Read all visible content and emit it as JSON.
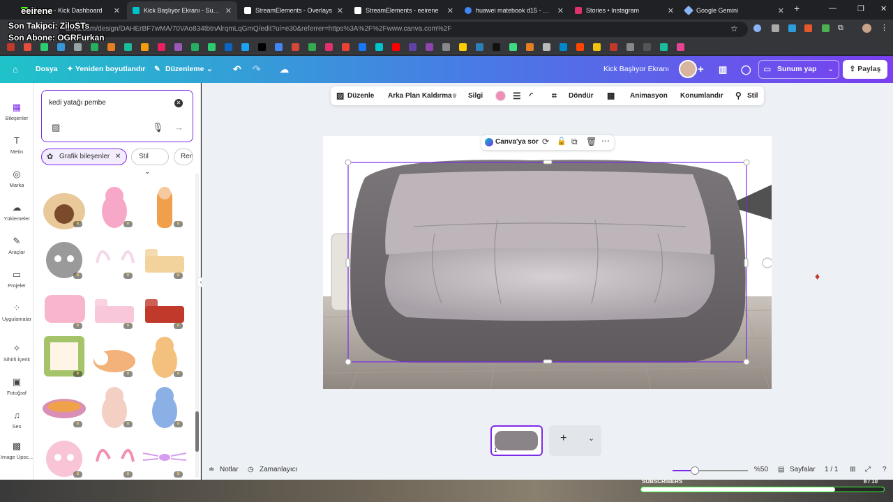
{
  "browser": {
    "tabs": [
      {
        "label": "Stream - Kick Dashboard",
        "fav": "#53fc18",
        "active": false
      },
      {
        "label": "Kick Başlıyor Ekranı - Sunum",
        "fav": "#00c4cc",
        "active": true
      },
      {
        "label": "StreamElements - Overlays",
        "fav": "#ffffff",
        "active": false
      },
      {
        "label": "StreamElements - eeirene",
        "fav": "#ffffff",
        "active": false
      },
      {
        "label": "huawei matebook d15 - Googl",
        "fav": "#4285f4",
        "active": false
      },
      {
        "label": "Stories • Instagram",
        "fav": "#e1306c",
        "active": false
      },
      {
        "label": "Google Gemini",
        "fav": "#8ab4f8",
        "active": false
      }
    ],
    "new_tab": "+",
    "url": "anva.com/design/DAHErBF7wMA/70VAo834tbtnAlrqmLqGmQ/edit?ui=e30&referrer=https%3A%2F%2Fwww.canva.com%2F"
  },
  "overlay": {
    "channel": "eeirene",
    "follower": "Son Takipci: ZiloSTs",
    "subscriber": "Son Abone: OGRFurkan"
  },
  "header": {
    "file": "Dosya",
    "resize": "Yeniden boyutlandır",
    "edit": "Düzenleme",
    "design_title": "Kick Başlıyor Ekranı",
    "present": "Sunum yap",
    "share": "Paylaş"
  },
  "rail": [
    {
      "label": "Bileşenler",
      "icon": "elements-icon",
      "glyph": "▦"
    },
    {
      "label": "Metin",
      "icon": "text-icon",
      "glyph": "T"
    },
    {
      "label": "Marka",
      "icon": "brand-icon",
      "glyph": "◎"
    },
    {
      "label": "Yüklemeler",
      "icon": "upload-icon",
      "glyph": "☁"
    },
    {
      "label": "Araçlar",
      "icon": "tools-icon",
      "glyph": "✎"
    },
    {
      "label": "Projeler",
      "icon": "folder-icon",
      "glyph": "▭"
    },
    {
      "label": "Uygulamalar",
      "icon": "apps-icon",
      "glyph": "⁘"
    },
    {
      "label": "Sihirli İçerik",
      "icon": "magic-icon",
      "glyph": "✧"
    },
    {
      "label": "Fotoğraf",
      "icon": "photo-icon",
      "glyph": "▣"
    },
    {
      "label": "Ses",
      "icon": "music-icon",
      "glyph": "♫"
    },
    {
      "label": "Image Upsc...",
      "icon": "upscale-icon",
      "glyph": "▩"
    }
  ],
  "search": {
    "value": "kedi yatağı pembe",
    "chip": "Grafik bileşenler",
    "style": "Stil",
    "color": "Renk"
  },
  "toolbar": {
    "edit": "Düzenle",
    "bg_remove": "Arka Plan Kaldırma",
    "eraser": "Silgi",
    "rotate": "Döndür",
    "animation": "Animasyon",
    "position": "Konumlandır",
    "style": "Stil",
    "swatch": "#f08fb6"
  },
  "canvas": {
    "ask_canva": "Canva'ya sor",
    "page_number": "1",
    "add_page": "+"
  },
  "footer": {
    "notes": "Notlar",
    "timer": "Zamanlayıcı",
    "zoom": "%50",
    "zoom_level": 0.5,
    "pages": "Sayfalar",
    "page_count": "1 / 1"
  },
  "stream": {
    "subscribers_label": "SUBSCRIBERS",
    "subscribers_count": "8 / 10",
    "subscribers_progress": 0.8
  }
}
